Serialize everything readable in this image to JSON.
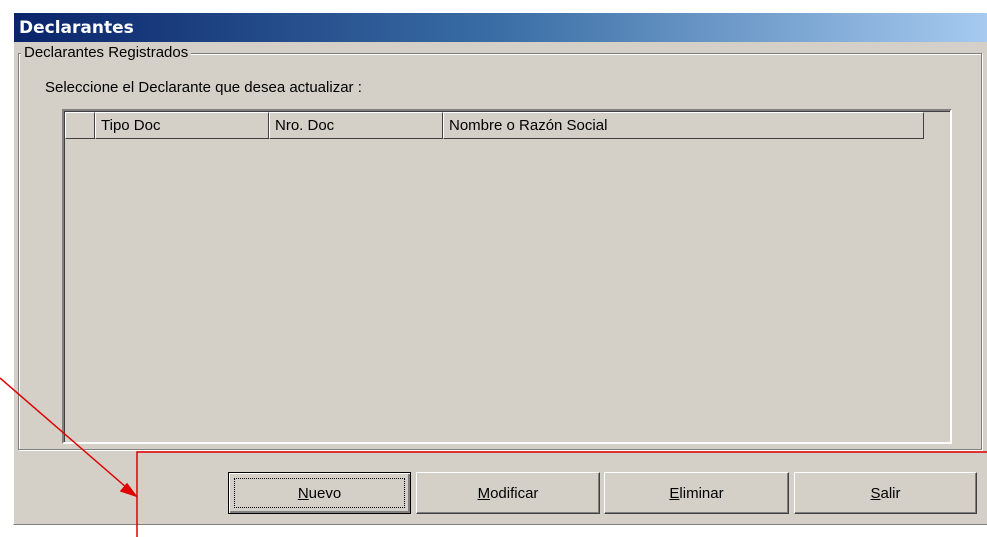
{
  "window": {
    "title": "Declarantes"
  },
  "group": {
    "legend": "Declarantes Registrados",
    "prompt": "Seleccione el Declarante que desea actualizar :"
  },
  "table": {
    "columns": [
      "",
      "Tipo Doc",
      "Nro. Doc",
      "Nombre o Razón Social"
    ],
    "rows": []
  },
  "buttons": [
    {
      "accel": "N",
      "rest": "uevo",
      "default": true
    },
    {
      "accel": "M",
      "rest": "odificar"
    },
    {
      "accel": "E",
      "rest": "liminar"
    },
    {
      "accel": "S",
      "rest": "alir"
    }
  ],
  "colors": {
    "annotation": "#e00000",
    "titlebar_start": "#0a246a",
    "titlebar_end": "#a6caf0",
    "face": "#d4d0c8"
  }
}
